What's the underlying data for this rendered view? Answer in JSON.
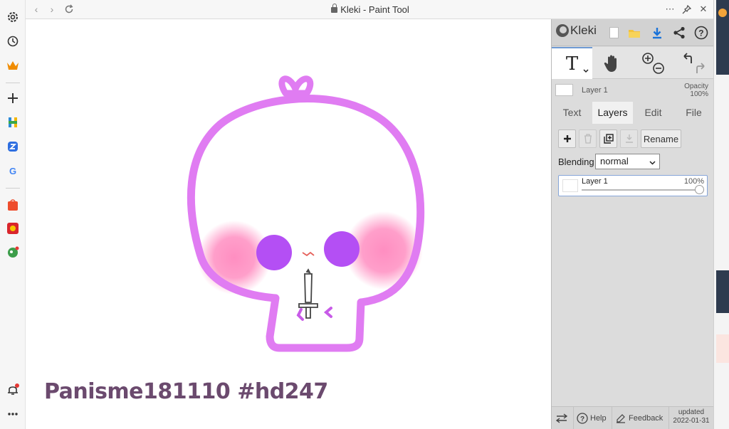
{
  "browser": {
    "title": "Kleki - Paint Tool",
    "sidebar_icons": [
      "settings-icon",
      "history-icon",
      "crown-icon",
      "plus-icon",
      "app-h-icon",
      "app-blue-icon",
      "google-icon",
      "shopee-icon",
      "game-icon",
      "ball-icon",
      "bell-icon",
      "more-icon"
    ]
  },
  "canvas": {
    "signature": "Panisme181110 #hd247"
  },
  "kleki": {
    "logo_text": "Kleki",
    "layer_info": {
      "name": "Layer 1",
      "opacity_label": "Opacity",
      "opacity_value": "100%"
    },
    "tabs": [
      {
        "label": "Text",
        "active": false
      },
      {
        "label": "Layers",
        "active": true
      },
      {
        "label": "Edit",
        "active": false
      },
      {
        "label": "File",
        "active": false
      }
    ],
    "layers_panel": {
      "rename_label": "Rename",
      "blending_label": "Blending",
      "blending_value": "normal",
      "layers": [
        {
          "name": "Layer 1",
          "opacity": "100%",
          "opacity_fraction": 1.0
        }
      ]
    },
    "bottom": {
      "help_label": "Help",
      "feedback_label": "Feedback",
      "updated_label": "updated",
      "updated_date": "2022-01-31"
    }
  },
  "colors": {
    "outline": "#e07cf2",
    "cheek": "#ff8ec1",
    "eye": "#b44ff4",
    "signature": "#6b4a6e",
    "accent": "#1a73d9"
  }
}
